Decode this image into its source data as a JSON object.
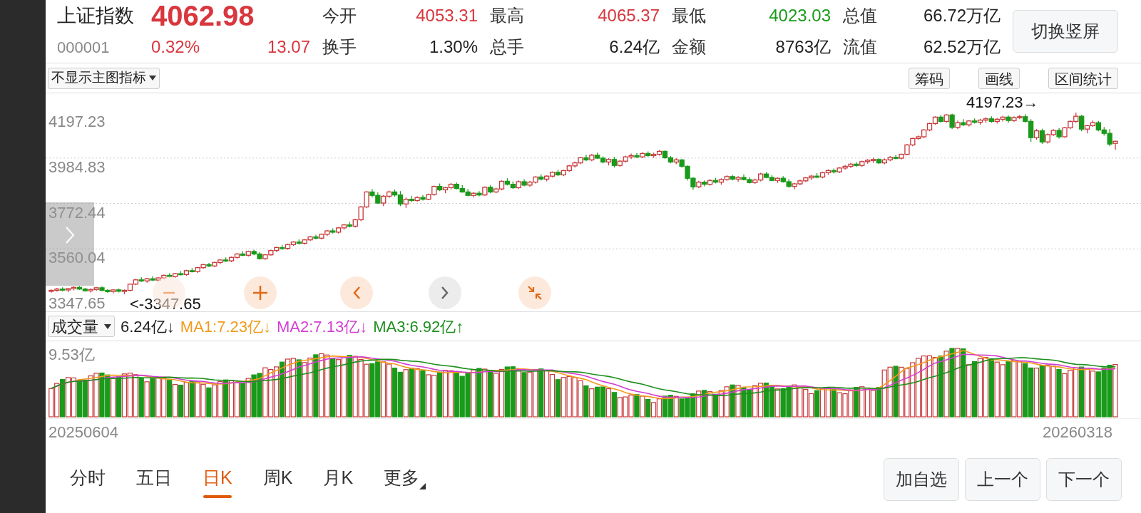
{
  "quote": {
    "name": "上证指数",
    "price": "4062.98",
    "code": "000001",
    "change_pct": "0.32%",
    "change": "13.07",
    "color": "#d9363e"
  },
  "stats": [
    {
      "label": "今开",
      "value": "4053.31",
      "color": "#d9363e"
    },
    {
      "label": "最高",
      "value": "4065.37",
      "color": "#d9363e"
    },
    {
      "label": "最低",
      "value": "4023.03",
      "color": "#1a9a1a"
    },
    {
      "label": "总值",
      "value": "66.72万亿",
      "color": "#222222"
    },
    {
      "label": "换手",
      "value": "1.30%",
      "color": "#222222"
    },
    {
      "label": "总手",
      "value": "6.24亿",
      "color": "#222222"
    },
    {
      "label": "金额",
      "value": "8763亿",
      "color": "#222222"
    },
    {
      "label": "流值",
      "value": "62.52万亿",
      "color": "#222222"
    }
  ],
  "orientation_button": "切换竖屏",
  "indicator_select": "不显示主图指标",
  "tool_buttons": [
    "筹码",
    "画线",
    "区间统计"
  ],
  "price_chart": {
    "max_marker": "4197.23→",
    "min_marker": "<-3347.65",
    "chart_data": {
      "type": "candlestick",
      "grid": true,
      "ylim": [
        3347.65,
        4197.23
      ],
      "yticks": [
        4197.23,
        3984.83,
        3772.44,
        3560.04,
        3347.65
      ],
      "ohlc": [
        [
          3362,
          3370,
          3355,
          3366
        ],
        [
          3366,
          3378,
          3360,
          3372
        ],
        [
          3372,
          3380,
          3362,
          3368
        ],
        [
          3368,
          3376,
          3358,
          3374
        ],
        [
          3374,
          3385,
          3366,
          3380
        ],
        [
          3380,
          3386,
          3368,
          3372
        ],
        [
          3372,
          3378,
          3360,
          3364
        ],
        [
          3364,
          3375,
          3356,
          3370
        ],
        [
          3370,
          3382,
          3364,
          3378
        ],
        [
          3378,
          3384,
          3362,
          3366
        ],
        [
          3366,
          3372,
          3354,
          3360
        ],
        [
          3360,
          3372,
          3352,
          3368
        ],
        [
          3368,
          3374,
          3356,
          3362
        ],
        [
          3362,
          3370,
          3347.65,
          3366
        ],
        [
          3366,
          3398,
          3362,
          3395
        ],
        [
          3395,
          3420,
          3390,
          3415
        ],
        [
          3415,
          3428,
          3405,
          3410
        ],
        [
          3410,
          3424,
          3402,
          3420
        ],
        [
          3420,
          3432,
          3410,
          3414
        ],
        [
          3414,
          3428,
          3408,
          3424
        ],
        [
          3424,
          3440,
          3418,
          3436
        ],
        [
          3436,
          3446,
          3426,
          3430
        ],
        [
          3430,
          3448,
          3424,
          3444
        ],
        [
          3444,
          3456,
          3436,
          3440
        ],
        [
          3440,
          3462,
          3434,
          3458
        ],
        [
          3458,
          3470,
          3450,
          3454
        ],
        [
          3454,
          3476,
          3448,
          3472
        ],
        [
          3472,
          3490,
          3466,
          3486
        ],
        [
          3486,
          3494,
          3474,
          3480
        ],
        [
          3480,
          3500,
          3474,
          3496
        ],
        [
          3496,
          3512,
          3488,
          3508
        ],
        [
          3508,
          3520,
          3498,
          3504
        ],
        [
          3504,
          3524,
          3498,
          3520
        ],
        [
          3520,
          3540,
          3514,
          3536
        ],
        [
          3536,
          3548,
          3526,
          3530
        ],
        [
          3530,
          3552,
          3524,
          3548
        ],
        [
          3548,
          3556,
          3530,
          3536
        ],
        [
          3536,
          3544,
          3510,
          3514
        ],
        [
          3514,
          3536,
          3508,
          3532
        ],
        [
          3532,
          3556,
          3528,
          3552
        ],
        [
          3552,
          3570,
          3546,
          3566
        ],
        [
          3566,
          3578,
          3556,
          3562
        ],
        [
          3562,
          3584,
          3556,
          3580
        ],
        [
          3580,
          3596,
          3574,
          3592
        ],
        [
          3592,
          3604,
          3580,
          3586
        ],
        [
          3586,
          3606,
          3580,
          3602
        ],
        [
          3602,
          3620,
          3596,
          3616
        ],
        [
          3616,
          3626,
          3604,
          3610
        ],
        [
          3610,
          3632,
          3604,
          3628
        ],
        [
          3628,
          3648,
          3620,
          3644
        ],
        [
          3644,
          3656,
          3632,
          3638
        ],
        [
          3638,
          3662,
          3632,
          3658
        ],
        [
          3658,
          3676,
          3650,
          3672
        ],
        [
          3672,
          3686,
          3660,
          3666
        ],
        [
          3666,
          3700,
          3660,
          3696
        ],
        [
          3696,
          3760,
          3690,
          3756
        ],
        [
          3756,
          3830,
          3750,
          3826
        ],
        [
          3826,
          3840,
          3800,
          3810
        ],
        [
          3810,
          3824,
          3770,
          3774
        ],
        [
          3774,
          3812,
          3760,
          3806
        ],
        [
          3806,
          3832,
          3798,
          3826
        ],
        [
          3826,
          3838,
          3804,
          3812
        ],
        [
          3812,
          3830,
          3760,
          3770
        ],
        [
          3770,
          3800,
          3752,
          3792
        ],
        [
          3792,
          3808,
          3778,
          3786
        ],
        [
          3786,
          3806,
          3780,
          3800
        ],
        [
          3800,
          3812,
          3786,
          3792
        ],
        [
          3792,
          3818,
          3788,
          3814
        ],
        [
          3814,
          3856,
          3808,
          3852
        ],
        [
          3852,
          3866,
          3830,
          3836
        ],
        [
          3836,
          3850,
          3820,
          3846
        ],
        [
          3846,
          3868,
          3838,
          3862
        ],
        [
          3862,
          3870,
          3838,
          3842
        ],
        [
          3842,
          3858,
          3822,
          3826
        ],
        [
          3826,
          3840,
          3806,
          3810
        ],
        [
          3810,
          3826,
          3800,
          3820
        ],
        [
          3820,
          3830,
          3806,
          3812
        ],
        [
          3812,
          3852,
          3808,
          3848
        ],
        [
          3848,
          3858,
          3820,
          3826
        ],
        [
          3826,
          3846,
          3820,
          3840
        ],
        [
          3840,
          3880,
          3834,
          3876
        ],
        [
          3876,
          3890,
          3856,
          3862
        ],
        [
          3862,
          3876,
          3840,
          3846
        ],
        [
          3846,
          3880,
          3840,
          3874
        ],
        [
          3874,
          3886,
          3852,
          3858
        ],
        [
          3858,
          3878,
          3850,
          3872
        ],
        [
          3872,
          3900,
          3866,
          3896
        ],
        [
          3896,
          3908,
          3880,
          3886
        ],
        [
          3886,
          3904,
          3876,
          3900
        ],
        [
          3900,
          3922,
          3894,
          3918
        ],
        [
          3918,
          3930,
          3900,
          3906
        ],
        [
          3906,
          3930,
          3900,
          3926
        ],
        [
          3926,
          3952,
          3920,
          3948
        ],
        [
          3948,
          3968,
          3940,
          3962
        ],
        [
          3962,
          3990,
          3956,
          3986
        ],
        [
          3986,
          4000,
          3970,
          3976
        ],
        [
          3976,
          4004,
          3970,
          3998
        ],
        [
          3998,
          4010,
          3980,
          3984
        ],
        [
          3984,
          3992,
          3960,
          3966
        ],
        [
          3966,
          3984,
          3950,
          3978
        ],
        [
          3978,
          3990,
          3940,
          3950
        ],
        [
          3950,
          3976,
          3944,
          3970
        ],
        [
          3970,
          3996,
          3964,
          3990
        ],
        [
          3990,
          4006,
          3980,
          3996
        ],
        [
          3996,
          4008,
          3984,
          3990
        ],
        [
          3990,
          4012,
          3984,
          4006
        ],
        [
          4006,
          4016,
          3990,
          3996
        ],
        [
          3996,
          4010,
          3986,
          4002
        ],
        [
          4002,
          4022,
          3996,
          4016
        ],
        [
          4016,
          4020,
          3980,
          3986
        ],
        [
          3986,
          3994,
          3960,
          3966
        ],
        [
          3966,
          3984,
          3956,
          3976
        ],
        [
          3976,
          3980,
          3940,
          3946
        ],
        [
          3946,
          3950,
          3880,
          3890
        ],
        [
          3890,
          3896,
          3836,
          3850
        ],
        [
          3850,
          3878,
          3844,
          3872
        ],
        [
          3872,
          3880,
          3852,
          3862
        ],
        [
          3862,
          3886,
          3856,
          3880
        ],
        [
          3880,
          3892,
          3866,
          3872
        ],
        [
          3872,
          3890,
          3860,
          3884
        ],
        [
          3884,
          3904,
          3878,
          3898
        ],
        [
          3898,
          3906,
          3880,
          3886
        ],
        [
          3886,
          3900,
          3874,
          3894
        ],
        [
          3894,
          3908,
          3880,
          3884
        ],
        [
          3884,
          3896,
          3866,
          3870
        ],
        [
          3870,
          3888,
          3864,
          3882
        ],
        [
          3882,
          3916,
          3876,
          3910
        ],
        [
          3910,
          3920,
          3890,
          3894
        ],
        [
          3894,
          3904,
          3876,
          3880
        ],
        [
          3880,
          3894,
          3868,
          3890
        ],
        [
          3890,
          3900,
          3870,
          3874
        ],
        [
          3874,
          3886,
          3846,
          3852
        ],
        [
          3852,
          3868,
          3838,
          3864
        ],
        [
          3864,
          3884,
          3858,
          3878
        ],
        [
          3878,
          3896,
          3872,
          3892
        ],
        [
          3892,
          3906,
          3882,
          3900
        ],
        [
          3900,
          3914,
          3890,
          3896
        ],
        [
          3896,
          3920,
          3890,
          3916
        ],
        [
          3916,
          3932,
          3906,
          3926
        ],
        [
          3926,
          3936,
          3912,
          3920
        ],
        [
          3920,
          3942,
          3914,
          3938
        ],
        [
          3938,
          3952,
          3930,
          3946
        ],
        [
          3946,
          3962,
          3938,
          3956
        ],
        [
          3956,
          3966,
          3944,
          3950
        ],
        [
          3950,
          3972,
          3944,
          3968
        ],
        [
          3968,
          3980,
          3958,
          3974
        ],
        [
          3974,
          3986,
          3962,
          3978
        ],
        [
          3978,
          3984,
          3956,
          3962
        ],
        [
          3962,
          3982,
          3956,
          3976
        ],
        [
          3976,
          3994,
          3970,
          3988
        ],
        [
          3988,
          4000,
          3978,
          3984
        ],
        [
          3984,
          4006,
          3978,
          4002
        ],
        [
          4002,
          4050,
          3998,
          4046
        ],
        [
          4046,
          4080,
          4040,
          4076
        ],
        [
          4076,
          4090,
          4070,
          4084
        ],
        [
          4084,
          4120,
          4078,
          4116
        ],
        [
          4116,
          4150,
          4110,
          4146
        ],
        [
          4146,
          4180,
          4140,
          4176
        ],
        [
          4176,
          4186,
          4150,
          4156
        ],
        [
          4156,
          4190,
          4150,
          4186
        ],
        [
          4186,
          4192,
          4120,
          4128
        ],
        [
          4128,
          4160,
          4120,
          4150
        ],
        [
          4150,
          4166,
          4134,
          4140
        ],
        [
          4140,
          4162,
          4132,
          4158
        ],
        [
          4158,
          4170,
          4146,
          4152
        ],
        [
          4152,
          4168,
          4140,
          4162
        ],
        [
          4162,
          4176,
          4150,
          4168
        ],
        [
          4168,
          4180,
          4150,
          4156
        ],
        [
          4156,
          4172,
          4146,
          4166
        ],
        [
          4166,
          4182,
          4156,
          4176
        ],
        [
          4176,
          4184,
          4150,
          4160
        ],
        [
          4160,
          4180,
          4154,
          4174
        ],
        [
          4174,
          4186,
          4166,
          4178
        ],
        [
          4178,
          4190,
          4150,
          4156
        ],
        [
          4156,
          4166,
          4060,
          4080
        ],
        [
          4080,
          4120,
          4070,
          4112
        ],
        [
          4112,
          4122,
          4050,
          4060
        ],
        [
          4060,
          4100,
          4052,
          4094
        ],
        [
          4094,
          4120,
          4088,
          4114
        ],
        [
          4114,
          4124,
          4076,
          4084
        ],
        [
          4084,
          4130,
          4080,
          4126
        ],
        [
          4126,
          4160,
          4120,
          4156
        ],
        [
          4156,
          4197.23,
          4150,
          4180
        ],
        [
          4180,
          4186,
          4110,
          4120
        ],
        [
          4120,
          4140,
          4100,
          4136
        ],
        [
          4136,
          4160,
          4130,
          4150
        ],
        [
          4150,
          4158,
          4110,
          4116
        ],
        [
          4116,
          4130,
          4090,
          4100
        ],
        [
          4100,
          4120,
          4040,
          4049.91
        ],
        [
          4053.31,
          4065.37,
          4023.03,
          4062.98
        ]
      ]
    }
  },
  "volume": {
    "select": "成交量",
    "current": "6.24亿↓",
    "ma": [
      {
        "label": "MA1:7.23亿↓",
        "color": "#f29a1b"
      },
      {
        "label": "MA2:7.13亿↓",
        "color": "#d23fd2"
      },
      {
        "label": "MA3:6.92亿↑",
        "color": "#1d8f1d"
      }
    ],
    "axis_max": "9.53亿"
  },
  "dates": [
    "20250604",
    "20260318"
  ],
  "periods": [
    {
      "label": "分时",
      "selected": false
    },
    {
      "label": "五日",
      "selected": false
    },
    {
      "label": "日K",
      "selected": true
    },
    {
      "label": "周K",
      "selected": false
    },
    {
      "label": "月K",
      "selected": false
    }
  ],
  "more": "更多",
  "actions": [
    "加自选",
    "上一个",
    "下一个"
  ]
}
